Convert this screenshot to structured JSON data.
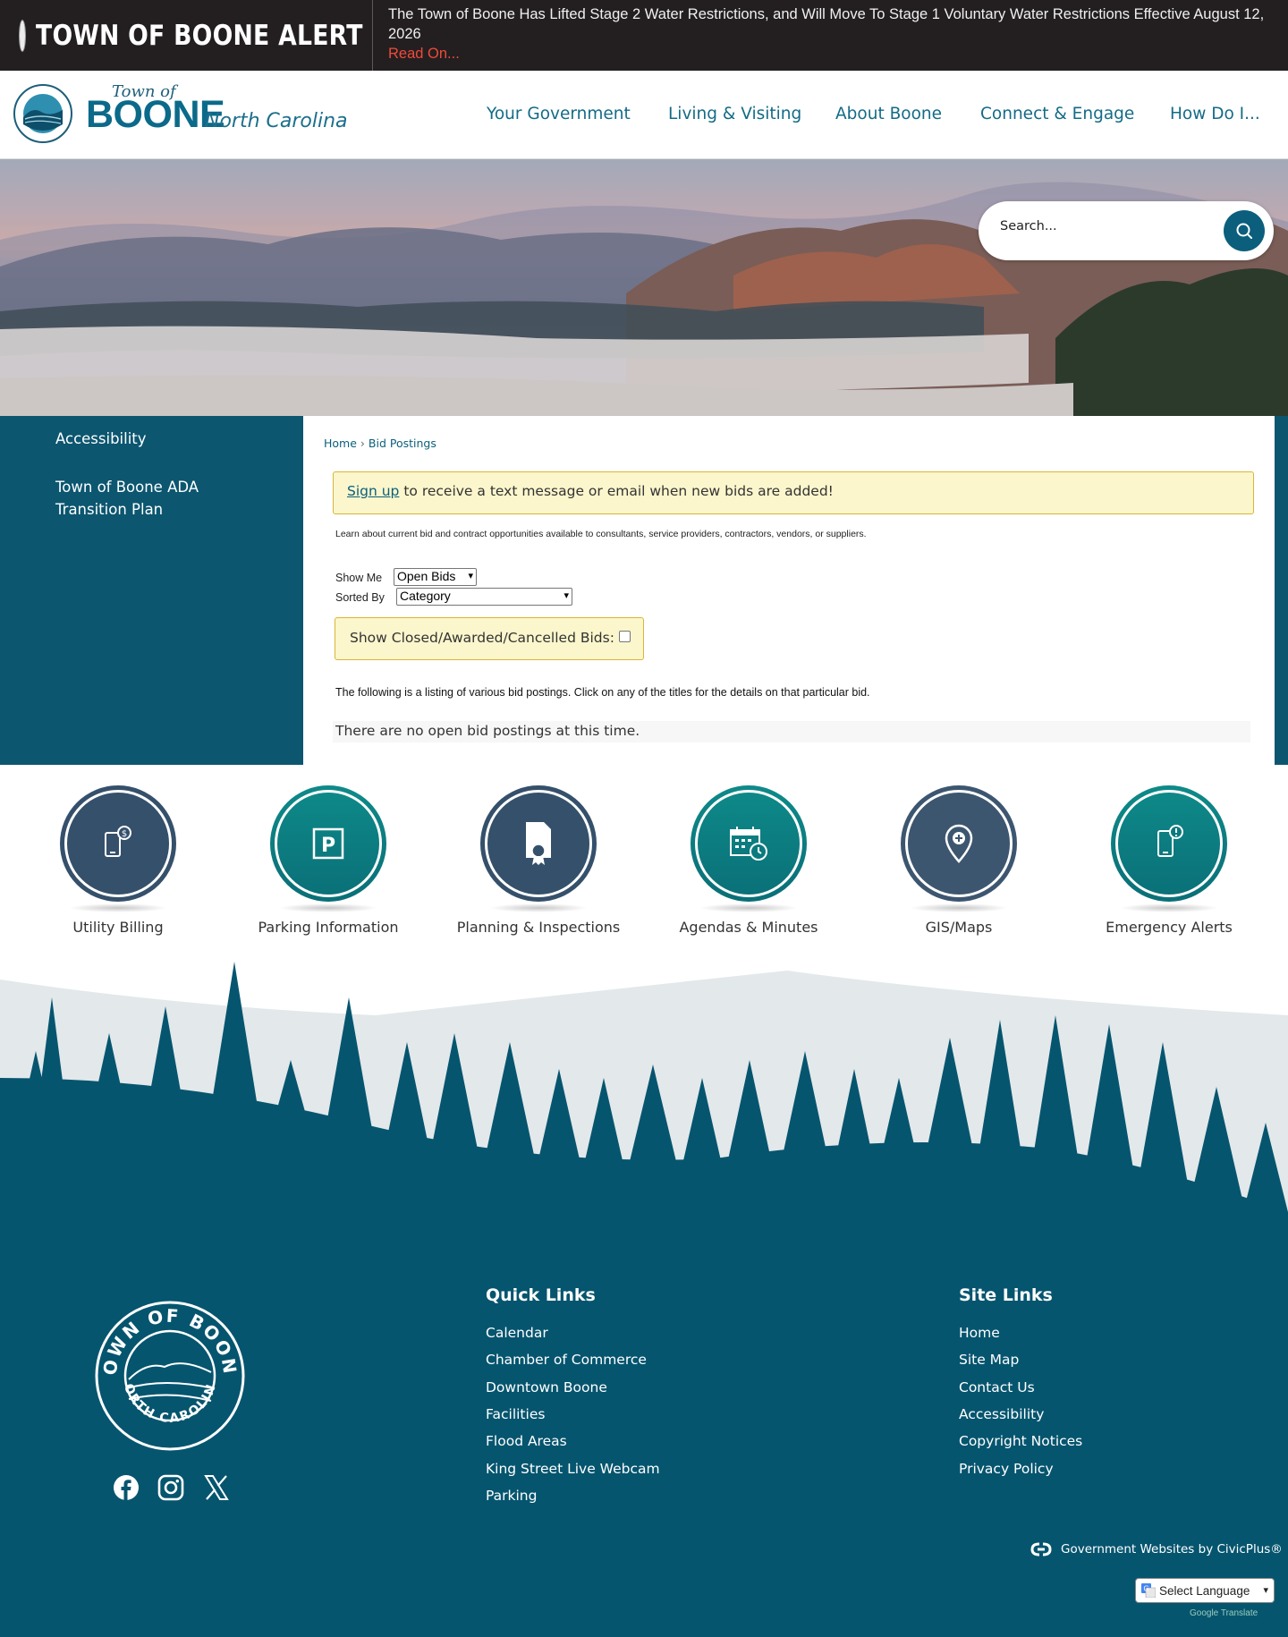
{
  "alert": {
    "title": "TOWN OF BOONE ALERT",
    "message": "The Town of Boone Has Lifted Stage 2 Water Restrictions, and Will Move To Stage 1 Voluntary Water Restrictions Effective August 12, 2026",
    "link": "Read On..."
  },
  "logo": {
    "town_of": "Town of",
    "name": "BOONE",
    "state": "North Carolina"
  },
  "nav": [
    "Your Government",
    "Living & Visiting",
    "About Boone",
    "Connect & Engage",
    "How Do I..."
  ],
  "search": {
    "placeholder": "Search..."
  },
  "sidebar": {
    "items": [
      "Accessibility",
      "Town of Boone ADA Transition Plan"
    ]
  },
  "breadcrumb": {
    "home": "Home",
    "separator": "›",
    "current": "Bid Postings"
  },
  "notice": {
    "link": "Sign up",
    "text": " to receive a text message or email when new bids are added!"
  },
  "description": "Learn about current bid and contract opportunities available to consultants, service providers, contractors, vendors, or suppliers.",
  "filters": {
    "show_me_label": "Show Me",
    "show_me_value": "Open Bids",
    "sorted_by_label": "Sorted By",
    "sorted_by_value": "Category",
    "closed_label": "Show Closed/Awarded/Cancelled Bids:"
  },
  "listing_text": "The following is a listing of various bid postings. Click on any of the titles for the details on that particular bid.",
  "no_bids": "There are no open bid postings at this time.",
  "quick_links": [
    {
      "label": "Utility Billing",
      "icon": "phone-dollar-icon"
    },
    {
      "label": "Parking Information",
      "icon": "parking-icon"
    },
    {
      "label": "Planning & Inspections",
      "icon": "document-ribbon-icon"
    },
    {
      "label": "Agendas & Minutes",
      "icon": "calendar-clock-icon"
    },
    {
      "label": "GIS/Maps",
      "icon": "map-pin-icon"
    },
    {
      "label": "Emergency Alerts",
      "icon": "phone-alert-icon"
    }
  ],
  "footer": {
    "seal_text": "TOWN OF BOONE NORTH CAROLINA",
    "quick_links_title": "Quick Links",
    "quick_links": [
      "Calendar",
      "Chamber of Commerce",
      "Downtown Boone",
      "Facilities",
      "Flood Areas",
      "King Street Live Webcam",
      "Parking"
    ],
    "site_links_title": "Site Links",
    "site_links": [
      "Home",
      "Site Map",
      "Contact Us",
      "Accessibility",
      "Copyright Notices",
      "Privacy Policy"
    ],
    "civicplus": "Government Websites by CivicPlus®",
    "language": "Select Language",
    "powered": "Google Translate"
  },
  "colors": {
    "brand_teal": "#06556f",
    "alert_red": "#ef4a3c",
    "notice_yellow": "#fbf6cc"
  }
}
